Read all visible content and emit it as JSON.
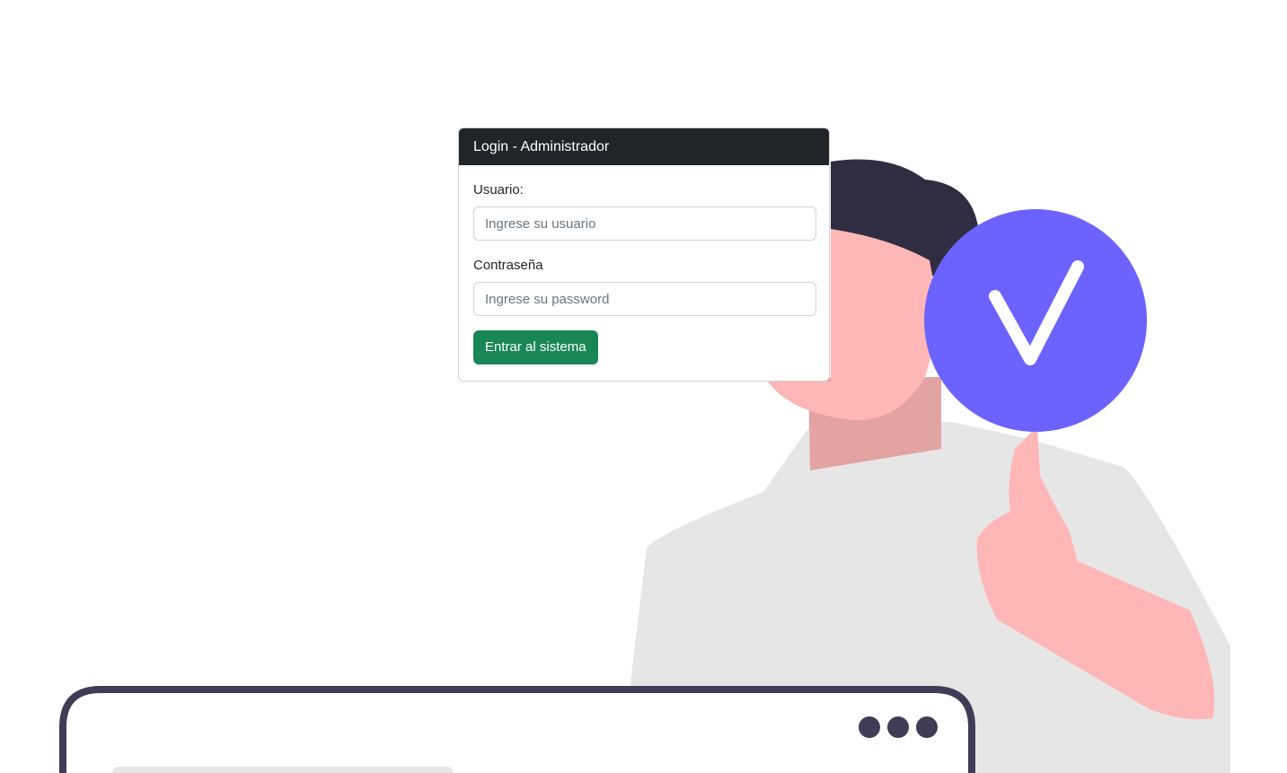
{
  "card": {
    "title": "Login - Administrador"
  },
  "form": {
    "user_label": "Usuario:",
    "user_placeholder": "Ingrese su usuario",
    "user_value": "",
    "password_label": "Contraseña",
    "password_placeholder": "Ingrese su password",
    "password_value": "",
    "submit_label": "Entrar al sistema"
  },
  "illustration": {
    "check_badge_icon": "check-icon",
    "window_dots_icon": "three-dots-icon"
  },
  "colors": {
    "header_bg": "#212529",
    "button_bg": "#198754",
    "badge": "#6c63ff",
    "skin": "#ffb6b6",
    "shirt": "#e6e6e6",
    "hair": "#2f2e41"
  }
}
